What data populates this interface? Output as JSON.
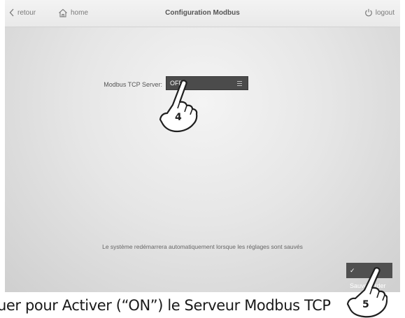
{
  "header": {
    "back_label": "retour",
    "home_label": "home",
    "title": "Configuration Modbus",
    "logout_label": "logout"
  },
  "form": {
    "modbus_label": "Modbus TCP Server:",
    "modbus_value": "OFF"
  },
  "notice": "Le système redémarrera automatiquement lorsque les réglages sont sauvés",
  "save_label": "✓ Sauvegarder",
  "callouts": {
    "step_4": "4",
    "step_5": "5"
  },
  "caption": "uer pour Activer (“ON”) le Serveur Modbus TCP",
  "icons": {
    "back": "chevron-left-icon",
    "home": "home-icon",
    "logout": "power-icon",
    "select_menu": "hamburger-icon",
    "pointer": "hand-pointer-icon"
  },
  "colors": {
    "select_bg": "#4b4b4b",
    "button_bg": "#505050"
  }
}
